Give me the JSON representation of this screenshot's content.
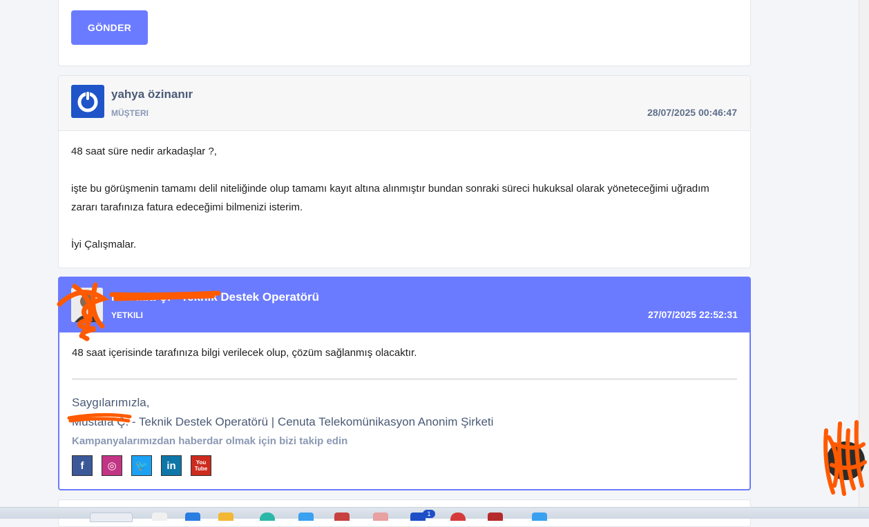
{
  "reply_form": {
    "send_label": "GÖNDER"
  },
  "messages": [
    {
      "author": "yahya özinanır",
      "role": "MÜŞTERI",
      "date": "28/07/2025 00:46:47",
      "paragraphs": [
        "48 saat süre nedir arkadaşlar ?,",
        "işte bu görüşmenin tamamı delil niteliğinde olup tamamı kayıt altına alınmıştır bundan sonraki süreci hukuksal olarak yöneteceğimi uğradım zararı tarafınıza fatura edeceğimi bilmenizi isterim.",
        "İyi Çalışmalar."
      ]
    },
    {
      "author": "Mustafa Ç. - Teknik Destek Operatörü",
      "role": "YETKILI",
      "date": "27/07/2025 22:52:31",
      "text": "48 saat içerisinde tarafınıza bilgi verilecek olup, çözüm sağlanmış olacaktır.",
      "signature": {
        "greeting": "Saygılarımızla,",
        "line": "Mustafa Ç. - Teknik Destek Operatörü | Cenuta Telekomünikasyon Anonim Şirketi",
        "follow": "Kampanyalarımızdan haberdar olmak için bizi takip edin",
        "social": [
          {
            "name": "facebook-icon",
            "glyph": "f"
          },
          {
            "name": "instagram-icon",
            "glyph": "◎"
          },
          {
            "name": "twitter-icon",
            "glyph": "🐦"
          },
          {
            "name": "linkedin-icon",
            "glyph": "in"
          },
          {
            "name": "youtube-icon",
            "glyph": "You Tube"
          }
        ]
      }
    }
  ],
  "taskbar": {
    "badge": "1"
  },
  "colors": {
    "accent": "#6b7bff",
    "redaction": "#ff5a00"
  }
}
